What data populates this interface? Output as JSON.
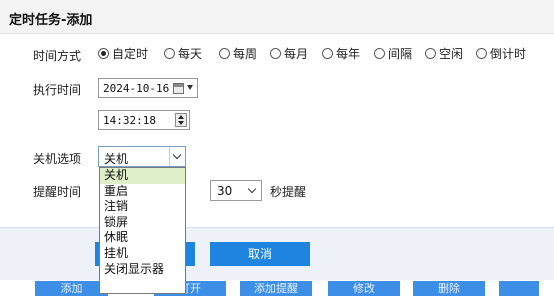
{
  "dialog": {
    "title": "定时任务-添加"
  },
  "form": {
    "mode_label": "时间方式",
    "modes": [
      {
        "label": "自定时",
        "checked": true
      },
      {
        "label": "每天",
        "checked": false
      },
      {
        "label": "每周",
        "checked": false
      },
      {
        "label": "每月",
        "checked": false
      },
      {
        "label": "每年",
        "checked": false
      },
      {
        "label": "间隔",
        "checked": false
      },
      {
        "label": "空闲",
        "checked": false
      },
      {
        "label": "倒计时",
        "checked": false
      }
    ],
    "exec_label": "执行时间",
    "date_value": "2024-10-16",
    "time_value": "14:32:18",
    "shutdown_label": "关机选项",
    "shutdown_value": "关机",
    "shutdown_options": [
      "关机",
      "重启",
      "注销",
      "锁屏",
      "休眠",
      "挂机",
      "关闭显示器"
    ],
    "remind_label": "提醒时间",
    "remind_value": "30",
    "remind_suffix": "秒提醒"
  },
  "footer": {
    "ok_label": "",
    "cancel_label": "取消"
  },
  "toolbar": {
    "add_label": "添加",
    "open_label": "打开",
    "add_remind_label": "添加提醒",
    "edit_label": "修改",
    "delete_label": "删除"
  },
  "colors": {
    "accent": "#1f84e0",
    "selected_option_bg": "#dff0c8",
    "toolbar_button": "#3c8ee6"
  }
}
